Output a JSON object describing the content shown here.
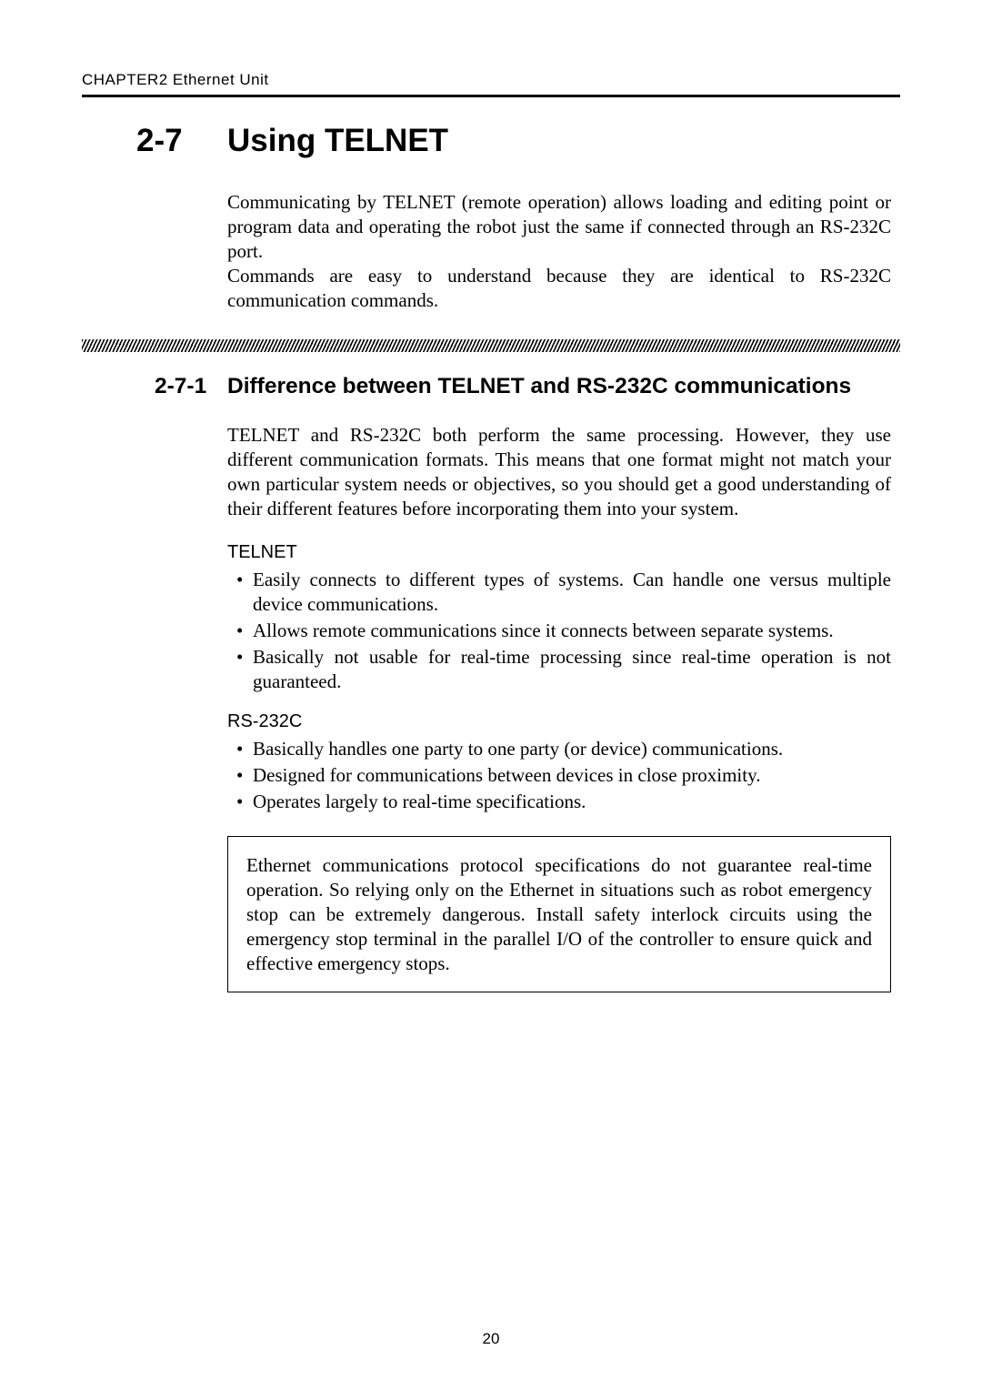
{
  "header": {
    "running": "CHAPTER2  Ethernet Unit"
  },
  "section": {
    "number": "2-7",
    "title": "Using TELNET",
    "intro_p1": "Communicating by TELNET (remote operation) allows loading and editing point or program data and operating the robot just the same if connected through an RS-232C port.",
    "intro_p2": "Commands are easy to understand because they are identical to RS-232C communication commands."
  },
  "subsection": {
    "number": "2-7-1",
    "title": "Difference between TELNET and RS-232C communications",
    "para": "TELNET and RS-232C both perform the same processing. However, they use different communication formats. This means that one format might not match your own particular system needs or objectives, so you should get a good understanding of their different features before incorporating them into your system.",
    "telnet_label": "TELNET",
    "telnet_items": [
      "Easily connects to different types of systems. Can handle one versus multiple device communications.",
      "Allows remote communications since it connects between separate systems.",
      "Basically not usable for real-time processing since real-time operation is not guaranteed."
    ],
    "rs232c_label": "RS-232C",
    "rs232c_items": [
      "Basically handles one party to one party (or device) communications.",
      "Designed for communications between devices in close proximity.",
      "Operates largely to real-time specifications."
    ],
    "note": "Ethernet communications protocol specifications do not guarantee real-time operation. So relying only on the Ethernet in situations such as robot emergency stop can be extremely dangerous. Install safety interlock circuits using the emergency stop terminal in the parallel I/O of the controller to ensure quick and effective emergency stops."
  },
  "page_number": "20"
}
